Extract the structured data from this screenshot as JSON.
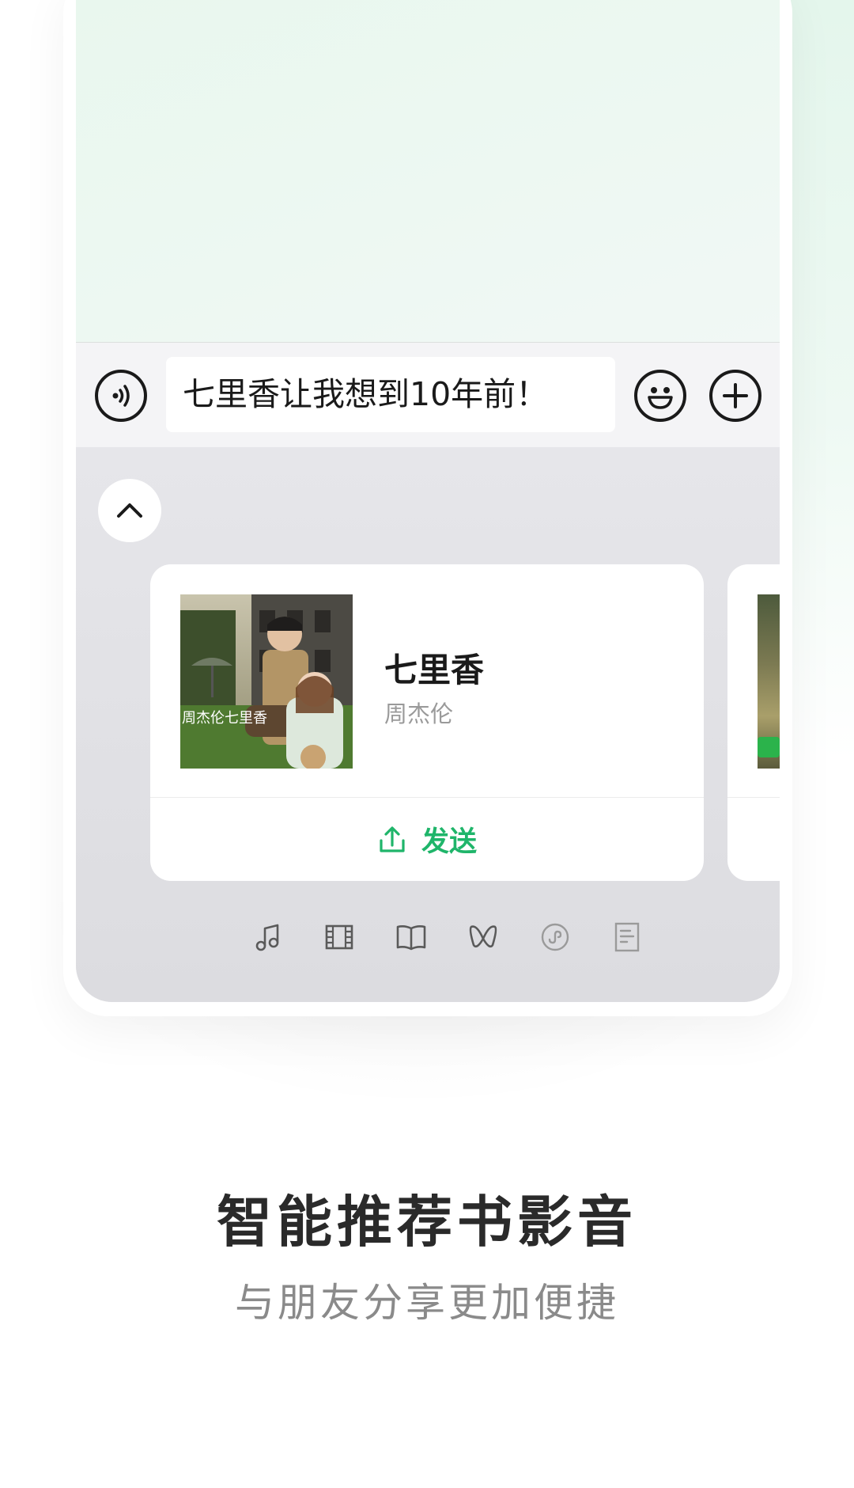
{
  "accent_color": "#1fb56a",
  "input_bar": {
    "message_text": "七里香让我想到10年前！",
    "icons": [
      "voice-icon",
      "emoji-icon",
      "plus-icon"
    ]
  },
  "panel": {
    "collapse_icon": "chevron-up-icon",
    "cards": [
      {
        "title": "七里香",
        "subtitle": "周杰伦",
        "album_art_text": "周杰伦七里香",
        "send_label": "发送",
        "send_icon": "share-upload-icon"
      }
    ],
    "category_tabs": [
      {
        "name": "music",
        "icon": "music-note-icon"
      },
      {
        "name": "movie",
        "icon": "film-icon"
      },
      {
        "name": "book",
        "icon": "book-icon"
      },
      {
        "name": "butterfly",
        "icon": "butterfly-icon"
      },
      {
        "name": "mini-program",
        "icon": "mini-program-icon"
      },
      {
        "name": "article",
        "icon": "document-icon"
      }
    ]
  },
  "caption": {
    "title": "智能推荐书影音",
    "subtitle": "与朋友分享更加便捷"
  }
}
